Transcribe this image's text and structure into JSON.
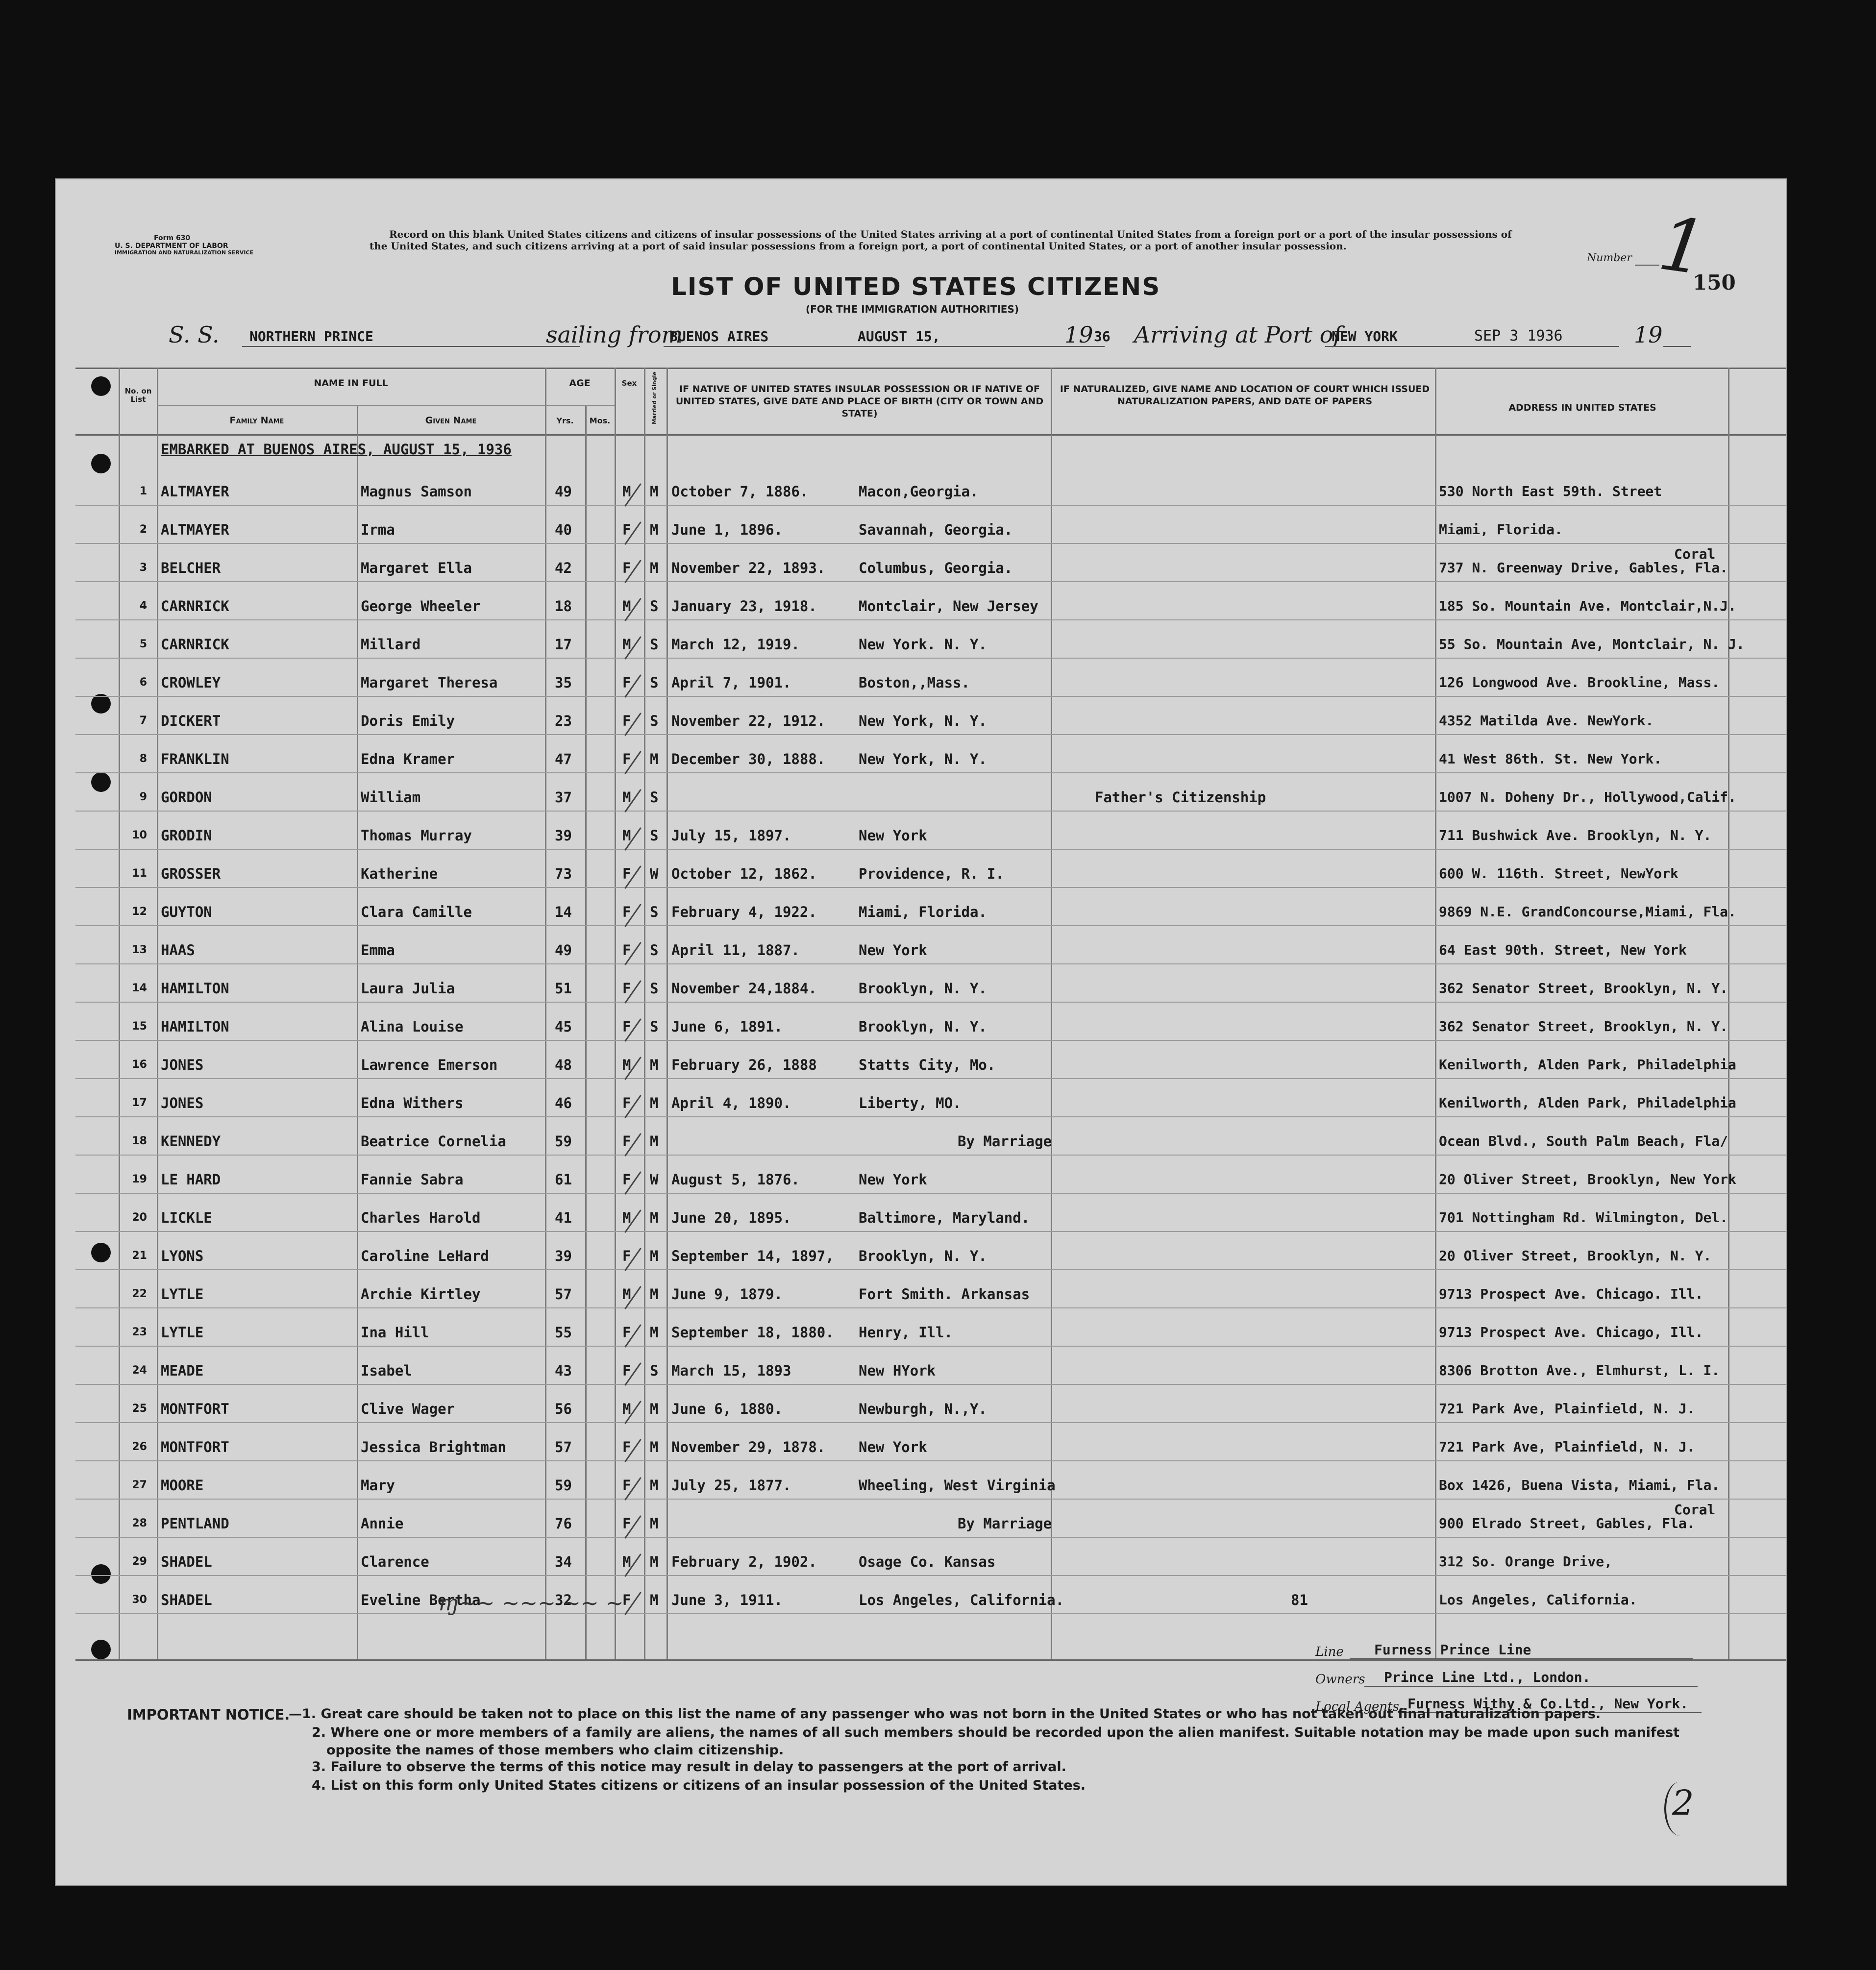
{
  "form": {
    "form_no": "Form 630",
    "department": "U. S. DEPARTMENT OF LABOR",
    "service": "IMMIGRATION AND NATURALIZATION SERVICE",
    "instructions": "Record on this blank United States citizens and citizens of insular possessions of the United States arriving at a port of continental United States from a foreign port or a port of the insular possessions of the United States, and such citizens arriving at a port of said insular possessions from a foreign port, a port of continental United States, or a port of another insular possession.",
    "title": "LIST OF UNITED STATES CITIZENS",
    "subtitle": "(FOR THE IMMIGRATION AUTHORITIES)",
    "number_label": "Number",
    "number_handwritten": "1",
    "page_number": "150",
    "ss_label": "S. S.",
    "ship_name": "NORTHERN PRINCE",
    "sailing_label": "sailing from",
    "sailing_from": "BUENOS AIRES",
    "sailing_date": "AUGUST 15,",
    "year_prefix": "19",
    "year_suffix": "36",
    "arriving_label": "Arriving at Port of",
    "arrival_port": "NEW YORK",
    "arrival_date": "SEP 3 1936",
    "year_prefix2": "19"
  },
  "columns": {
    "no": "No. on List",
    "name_in_full": "NAME IN FULL",
    "family": "Family Name",
    "given": "Given Name",
    "age": "AGE",
    "yrs": "Yrs.",
    "mos": "Mos.",
    "sex": "Sex",
    "married": "Married or Single",
    "birth": "IF NATIVE OF UNITED STATES INSULAR POSSESSION OR IF NATIVE OF UNITED STATES, GIVE DATE AND PLACE OF BIRTH (CITY OR TOWN AND STATE)",
    "naturalized": "IF NATURALIZED, GIVE NAME AND LOCATION OF COURT WHICH ISSUED NATURALIZATION PAPERS, AND DATE OF PAPERS",
    "address": "ADDRESS IN UNITED STATES"
  },
  "embarked": "EMBARKED AT BUENOS AIRES, AUGUST 15, 1936",
  "rows": [
    {
      "no": "1",
      "family": "ALTMAYER",
      "given": "Magnus Samson",
      "age": "49",
      "sex": "M",
      "ms": "M",
      "birth_date": "October 7, 1886.",
      "birth_place": "Macon,Georgia.",
      "nat": "",
      "address": "530 North East 59th. Street"
    },
    {
      "no": "2",
      "family": "ALTMAYER",
      "given": "Irma",
      "age": "40",
      "sex": "F",
      "ms": "M",
      "birth_date": "June 1, 1896.",
      "birth_place": "Savannah, Georgia.",
      "nat": "",
      "address": "Miami, Florida."
    },
    {
      "no": "3",
      "family": "BELCHER",
      "given": "Margaret Ella",
      "age": "42",
      "sex": "F",
      "ms": "M",
      "birth_date": "November 22, 1893.",
      "birth_place": "Columbus, Georgia.",
      "nat": "",
      "address": "737 N. Greenway Drive, Gables, Fla.",
      "address_above": "Coral"
    },
    {
      "no": "4",
      "family": "CARNRICK",
      "given": "George Wheeler",
      "age": "18",
      "sex": "M",
      "ms": "S",
      "birth_date": "January 23, 1918.",
      "birth_place": "Montclair, New Jersey",
      "nat": "",
      "address": "185 So. Mountain Ave. Montclair,N.J."
    },
    {
      "no": "5",
      "family": "CARNRICK",
      "given": "Millard",
      "age": "17",
      "sex": "M",
      "ms": "S",
      "birth_date": "March 12, 1919.",
      "birth_place": "New York. N. Y.",
      "nat": "",
      "address": "55 So. Mountain Ave, Montclair, N. J."
    },
    {
      "no": "6",
      "family": "CROWLEY",
      "given": "Margaret Theresa",
      "age": "35",
      "sex": "F",
      "ms": "S",
      "birth_date": "April 7, 1901.",
      "birth_place": "Boston,,Mass.",
      "nat": "",
      "address": "126 Longwood Ave. Brookline, Mass."
    },
    {
      "no": "7",
      "family": "DICKERT",
      "given": "Doris Emily",
      "age": "23",
      "sex": "F",
      "ms": "S",
      "birth_date": "November 22, 1912.",
      "birth_place": "New York, N. Y.",
      "nat": "",
      "address": "4352 Matilda Ave. NewYork."
    },
    {
      "no": "8",
      "family": "FRANKLIN",
      "given": "Edna Kramer",
      "age": "47",
      "sex": "F",
      "ms": "M",
      "birth_date": "December 30, 1888.",
      "birth_place": "New York, N. Y.",
      "nat": "",
      "address": "41 West 86th. St. New York."
    },
    {
      "no": "9",
      "family": "GORDON",
      "given": "William",
      "age": "37",
      "sex": "M",
      "ms": "S",
      "birth_date": "",
      "birth_place": "",
      "nat": "Father's Citizenship",
      "address": "1007 N. Doheny Dr., Hollywood,Calif."
    },
    {
      "no": "10",
      "family": "GRODIN",
      "given": "Thomas Murray",
      "age": "39",
      "sex": "M",
      "ms": "S",
      "birth_date": "July 15, 1897.",
      "birth_place": "New York",
      "nat": "",
      "address": "711 Bushwick Ave. Brooklyn, N. Y."
    },
    {
      "no": "11",
      "family": "GROSSER",
      "given": "Katherine",
      "age": "73",
      "sex": "F",
      "ms": "W",
      "birth_date": "October 12, 1862.",
      "birth_place": "Providence, R. I.",
      "nat": "",
      "address": "600 W. 116th. Street, NewYork"
    },
    {
      "no": "12",
      "family": "GUYTON",
      "given": "Clara Camille",
      "age": "14",
      "sex": "F",
      "ms": "S",
      "birth_date": "February 4, 1922.",
      "birth_place": "Miami, Florida.",
      "nat": "",
      "address": "9869 N.E. GrandConcourse,Miami, Fla."
    },
    {
      "no": "13",
      "family": "HAAS",
      "given": "Emma",
      "age": "49",
      "sex": "F",
      "ms": "S",
      "birth_date": "April 11, 1887.",
      "birth_place": "New York",
      "nat": "",
      "address": "64 East 90th. Street, New York"
    },
    {
      "no": "14",
      "family": "HAMILTON",
      "given": "Laura Julia",
      "age": "51",
      "sex": "F",
      "ms": "S",
      "birth_date": "November 24,1884.",
      "birth_place": "Brooklyn, N. Y.",
      "nat": "",
      "address": "362 Senator Street, Brooklyn, N. Y."
    },
    {
      "no": "15",
      "family": "HAMILTON",
      "given": "Alina Louise",
      "age": "45",
      "sex": "F",
      "ms": "S",
      "birth_date": "June 6, 1891.",
      "birth_place": "Brooklyn, N. Y.",
      "nat": "",
      "address": "362 Senator Street, Brooklyn, N. Y."
    },
    {
      "no": "16",
      "family": "JONES",
      "given": "Lawrence Emerson",
      "age": "48",
      "sex": "M",
      "ms": "M",
      "birth_date": "February 26, 1888",
      "birth_place": "Statts City, Mo.",
      "nat": "",
      "address": "Kenilworth, Alden Park, Philadelphia"
    },
    {
      "no": "17",
      "family": "JONES",
      "given": "Edna Withers",
      "age": "46",
      "sex": "F",
      "ms": "M",
      "birth_date": "April 4, 1890.",
      "birth_place": "Liberty, MO.",
      "nat": "",
      "address": "Kenilworth, Alden Park, Philadelphia"
    },
    {
      "no": "18",
      "family": "KENNEDY",
      "given": "Beatrice Cornelia",
      "age": "59",
      "sex": "F",
      "ms": "M",
      "birth_date": "",
      "birth_place": "By Marriage",
      "nat": "",
      "address": "Ocean Blvd., South Palm Beach, Fla/"
    },
    {
      "no": "19",
      "family": "LE HARD",
      "given": "Fannie Sabra",
      "age": "61",
      "sex": "F",
      "ms": "W",
      "birth_date": "August 5, 1876.",
      "birth_place": "New York",
      "nat": "",
      "address": "20 Oliver Street, Brooklyn, New York"
    },
    {
      "no": "20",
      "family": "LICKLE",
      "given": "Charles Harold",
      "age": "41",
      "sex": "M",
      "ms": "M",
      "birth_date": "June 20, 1895.",
      "birth_place": "Baltimore, Maryland.",
      "nat": "",
      "address": "701 Nottingham Rd. Wilmington, Del."
    },
    {
      "no": "21",
      "family": "LYONS",
      "given": "Caroline LeHard",
      "age": "39",
      "sex": "F",
      "ms": "M",
      "birth_date": "September 14, 1897,",
      "birth_place": "Brooklyn, N. Y.",
      "nat": "",
      "address": "20 Oliver Street, Brooklyn, N. Y."
    },
    {
      "no": "22",
      "family": "LYTLE",
      "given": "Archie Kirtley",
      "age": "57",
      "sex": "M",
      "ms": "M",
      "birth_date": "June 9, 1879.",
      "birth_place": "Fort Smith. Arkansas",
      "nat": "",
      "address": "9713 Prospect Ave. Chicago. Ill."
    },
    {
      "no": "23",
      "family": "LYTLE",
      "given": "Ina Hill",
      "age": "55",
      "sex": "F",
      "ms": "M",
      "birth_date": "September 18, 1880.",
      "birth_place": "Henry, Ill.",
      "nat": "",
      "address": "9713 Prospect Ave. Chicago, Ill."
    },
    {
      "no": "24",
      "family": "MEADE",
      "given": "Isabel",
      "age": "43",
      "sex": "F",
      "ms": "S",
      "birth_date": "March 15, 1893",
      "birth_place": "New HYork",
      "nat": "",
      "address": "8306 Brotton Ave., Elmhurst, L. I."
    },
    {
      "no": "25",
      "family": "MONTFORT",
      "given": "Clive Wager",
      "age": "56",
      "sex": "M",
      "ms": "M",
      "birth_date": "June 6, 1880.",
      "birth_place": "Newburgh, N.,Y.",
      "nat": "",
      "address": "721 Park Ave, Plainfield, N. J."
    },
    {
      "no": "26",
      "family": "MONTFORT",
      "given": "Jessica Brightman",
      "age": "57",
      "sex": "F",
      "ms": "M",
      "birth_date": "November 29, 1878.",
      "birth_place": "New York",
      "nat": "",
      "address": "721 Park Ave, Plainfield, N. J."
    },
    {
      "no": "27",
      "family": "MOORE",
      "given": "Mary",
      "age": "59",
      "sex": "F",
      "ms": "M",
      "birth_date": "July 25, 1877.",
      "birth_place": "Wheeling, West Virginia",
      "nat": "",
      "address": "Box 1426, Buena Vista, Miami, Fla."
    },
    {
      "no": "28",
      "family": "PENTLAND",
      "given": "Annie",
      "age": "76",
      "sex": "F",
      "ms": "M",
      "birth_date": "",
      "birth_place": "By Marriage",
      "nat": "",
      "address": "900 Elrado Street, Gables, Fla.",
      "address_above": "Coral"
    },
    {
      "no": "29",
      "family": "SHADEL",
      "given": "Clarence",
      "age": "34",
      "sex": "M",
      "ms": "M",
      "birth_date": "February 2, 1902.",
      "birth_place": "Osage Co. Kansas",
      "nat": "",
      "address": "312 So. Orange Drive,"
    },
    {
      "no": "30",
      "family": "SHADEL",
      "given": "Eveline Bertha",
      "age": "32",
      "sex": "F",
      "ms": "M",
      "birth_date": "June 3, 1911.",
      "birth_place": "Los Angeles, California.",
      "nat": "81",
      "address": "Los Angeles, California."
    }
  ],
  "footer": {
    "line_label": "Line",
    "line_value": "Furness Prince Line",
    "owners_label": "Owners",
    "owners_value": "Prince Line Ltd., London.",
    "agents_label": "Local Agents",
    "agents_value": "Furness Withy & Co.Ltd., New York.",
    "notice_title": "IMPORTANT NOTICE.",
    "notice_1": "—1. Great care should be taken not to place on this list the name of any passenger who was not born in the United States or who has not taken out final naturalization papers.",
    "notice_2": "2. Where one or more members of a family are aliens, the names of all such members should be recorded upon the alien manifest. Suitable notation may be made upon such manifest opposite the names of those members who claim citizenship.",
    "notice_3": "3. Failure to observe the terms of this notice may result in delay to passengers at the port of arrival.",
    "notice_4": "4. List on this form only United States citizens or citizens of an insular possession of the United States.",
    "corner_mark": "2"
  }
}
